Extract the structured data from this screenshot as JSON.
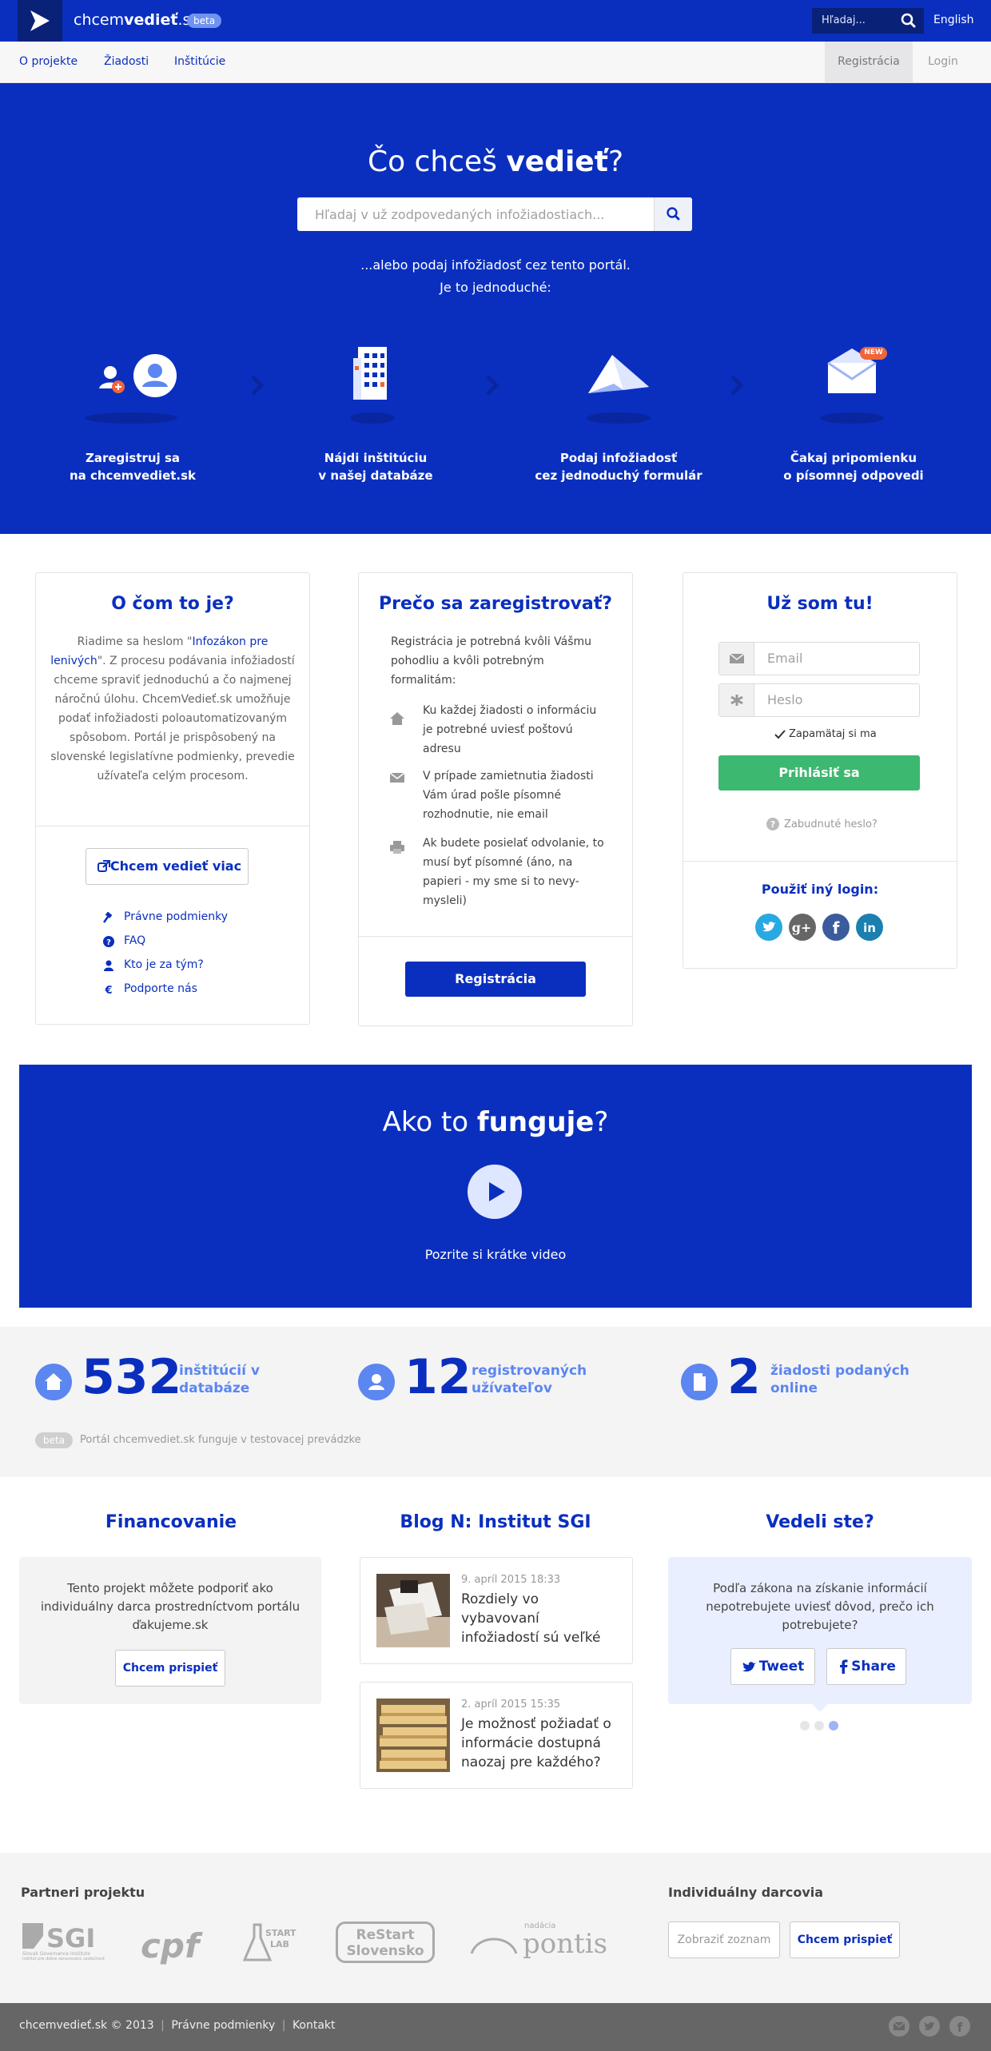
{
  "header": {
    "logo_prefix": "chcem",
    "logo_bold": "vedieť",
    "logo_suffix": ".sk",
    "beta_label": "beta",
    "search_placeholder": "Hľadaj...",
    "lang_label": "English"
  },
  "nav": {
    "items": [
      {
        "label": "O projekte"
      },
      {
        "label": "Žiadosti"
      },
      {
        "label": "Inštitúcie"
      }
    ],
    "register_label": "Registrácia",
    "login_label": "Login"
  },
  "hero": {
    "title_prefix": "Čo chceš ",
    "title_bold": "vedieť",
    "title_suffix": "?",
    "search_placeholder": "Hľadaj v už zodpovedaných infožiadostiach...",
    "sub1": "...alebo podaj infožiadosť cez tento portál.",
    "sub2": "Je to jednoduché:",
    "steps": [
      {
        "line1": "Zaregistruj sa",
        "line2": "na chcemvediet.sk"
      },
      {
        "line1": "Nájdi inštitúciu",
        "line2": "v našej databáze"
      },
      {
        "line1": "Podaj infožiadosť",
        "line2": "cez jednoduchý formulár"
      },
      {
        "line1": "Čakaj pripomienku",
        "line2": "o písomnej odpovedi"
      }
    ],
    "new_badge": "NEW"
  },
  "about": {
    "title": "O čom to je?",
    "text_before_link": "Riadime sa heslom \"",
    "link_text": "Infozákon pre lenivých",
    "text_after_link": "\". Z procesu podávania infožiadostí chceme spraviť jednoduchú a čo najmenej náročnú úlohu. ChcemVedieť.sk umožňuje podať infožiadosti poloautomatizovaným spôsobom. Portál je prispôsobený na slovenské legislatívne podmienky, prevedie užívateľa celým procesom.",
    "more_button": "Chcem vedieť viac",
    "links": [
      {
        "label": "Právne podmienky",
        "icon": "gavel-icon"
      },
      {
        "label": "FAQ",
        "icon": "question-icon"
      },
      {
        "label": "Kto je za tým?",
        "icon": "person-icon"
      },
      {
        "label": "Podporte nás",
        "icon": "euro-icon"
      }
    ]
  },
  "why": {
    "title": "Prečo sa zaregistrovať?",
    "intro": "Registrácia je potrebná kvôli Vášmu pohodliu a kvôli potrebným formalitám:",
    "reasons": [
      {
        "icon": "home-icon",
        "text": "Ku každej žiadosti o informáciu je potrebné uviesť poštovú adresu"
      },
      {
        "icon": "envelope-icon",
        "text": "V prípade zamietnutia žiadosti Vám úrad pošle písomné rozhodnutie, nie email"
      },
      {
        "icon": "printer-icon",
        "text": "Ak budete posielať odvolanie, to musí byť písomné (áno, na papieri - my sme si to nevy-mysleli)"
      }
    ],
    "register_button": "Registrácia"
  },
  "login": {
    "title": "Už som tu!",
    "email_placeholder": "Email",
    "password_placeholder": "Heslo",
    "remember_label": "Zapamätaj si ma",
    "submit_label": "Prihlásiť sa",
    "forgot_label": "Zabudnuté heslo?",
    "other_login_label": "Použiť iný login:",
    "social": [
      {
        "name": "twitter",
        "color": "#29a9e1"
      },
      {
        "name": "google-plus",
        "color": "#666666"
      },
      {
        "name": "facebook",
        "color": "#3b5b9c"
      },
      {
        "name": "linkedin",
        "color": "#1b7fb0"
      }
    ]
  },
  "video": {
    "title_prefix": "Ako to ",
    "title_bold": "funguje",
    "title_suffix": "?",
    "caption": "Pozrite si krátke video"
  },
  "stats": {
    "items": [
      {
        "number": "532",
        "line1": "inštitúcií v",
        "line2": "databáze",
        "icon": "home-icon"
      },
      {
        "number": "12",
        "line1": "registrovaných",
        "line2": "užívateľov",
        "icon": "person-icon"
      },
      {
        "number": "2",
        "line1": "žiadosti podaných",
        "line2": "online",
        "icon": "document-icon"
      }
    ],
    "beta_label": "beta",
    "beta_note": "Portál chcemvediet.sk funguje v testovacej prevádzke"
  },
  "financing": {
    "title": "Financovanie",
    "text": "Tento projekt môžete podporiť ako individuálny darca prostredníctvom portálu ďakujeme.sk",
    "button": "Chcem prispieť"
  },
  "blog": {
    "title": "Blog N: Institut SGI",
    "posts": [
      {
        "date": "9. apríl 2015 18:33",
        "title": "Rozdiely vo vybavovaní infožiadostí sú veľké"
      },
      {
        "date": "2. apríl 2015 15:35",
        "title": "Je možnosť požiadať o informácie dostupná naozaj pre každého?"
      }
    ]
  },
  "facts": {
    "title": "Vedeli ste?",
    "text": "Podľa zákona na získanie informácií nepotrebujete uviesť dôvod, prečo ich potrebujete?",
    "tweet_label": "Tweet",
    "share_label": "Share"
  },
  "partners": {
    "title": "Partneri projektu",
    "logos": [
      {
        "text": "SGI",
        "sub1": "Slovak Governance Institute",
        "sub2": "Inštitút pre dobre spravovanú spoločnosť"
      },
      {
        "text": "cpf"
      },
      {
        "text": "START",
        "sub1": "LAB"
      },
      {
        "text": "ReStart",
        "sub1": "Slovensko"
      },
      {
        "text": "pontis",
        "sub1": "nadácia"
      }
    ],
    "donors_title": "Individuálny darcovia",
    "show_list": "Zobraziť zoznam",
    "contribute": "Chcem prispieť"
  },
  "footer": {
    "copyright": "chcemvedieť.sk © 2013",
    "sep": "|",
    "terms": "Právne podmienky",
    "contact": "Kontakt"
  }
}
